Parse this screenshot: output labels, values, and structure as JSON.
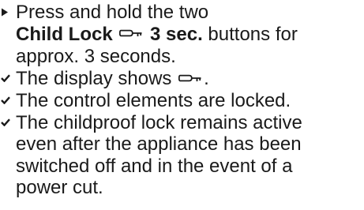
{
  "steps": [
    {
      "marker": "triangle-bullet-icon",
      "line1": "Press and hold the two",
      "line2_bold": "Child Lock",
      "line2_icon": "child-lock-key-icon",
      "line2_bold_tail": "3 sec.",
      "line2_rest": "buttons for",
      "line3": "approx. 3 seconds."
    }
  ],
  "results": [
    {
      "marker": "checkmark-icon",
      "text_before": "The display shows",
      "icon": "child-lock-key-icon",
      "text_after": "."
    },
    {
      "marker": "checkmark-icon",
      "text": "The control elements are locked."
    },
    {
      "marker": "checkmark-icon",
      "lines": [
        "The childproof lock remains active",
        "even after the appliance has been",
        "switched off and in the event of a",
        "power cut."
      ]
    }
  ],
  "colors": {
    "text": "#1a1a1a"
  }
}
